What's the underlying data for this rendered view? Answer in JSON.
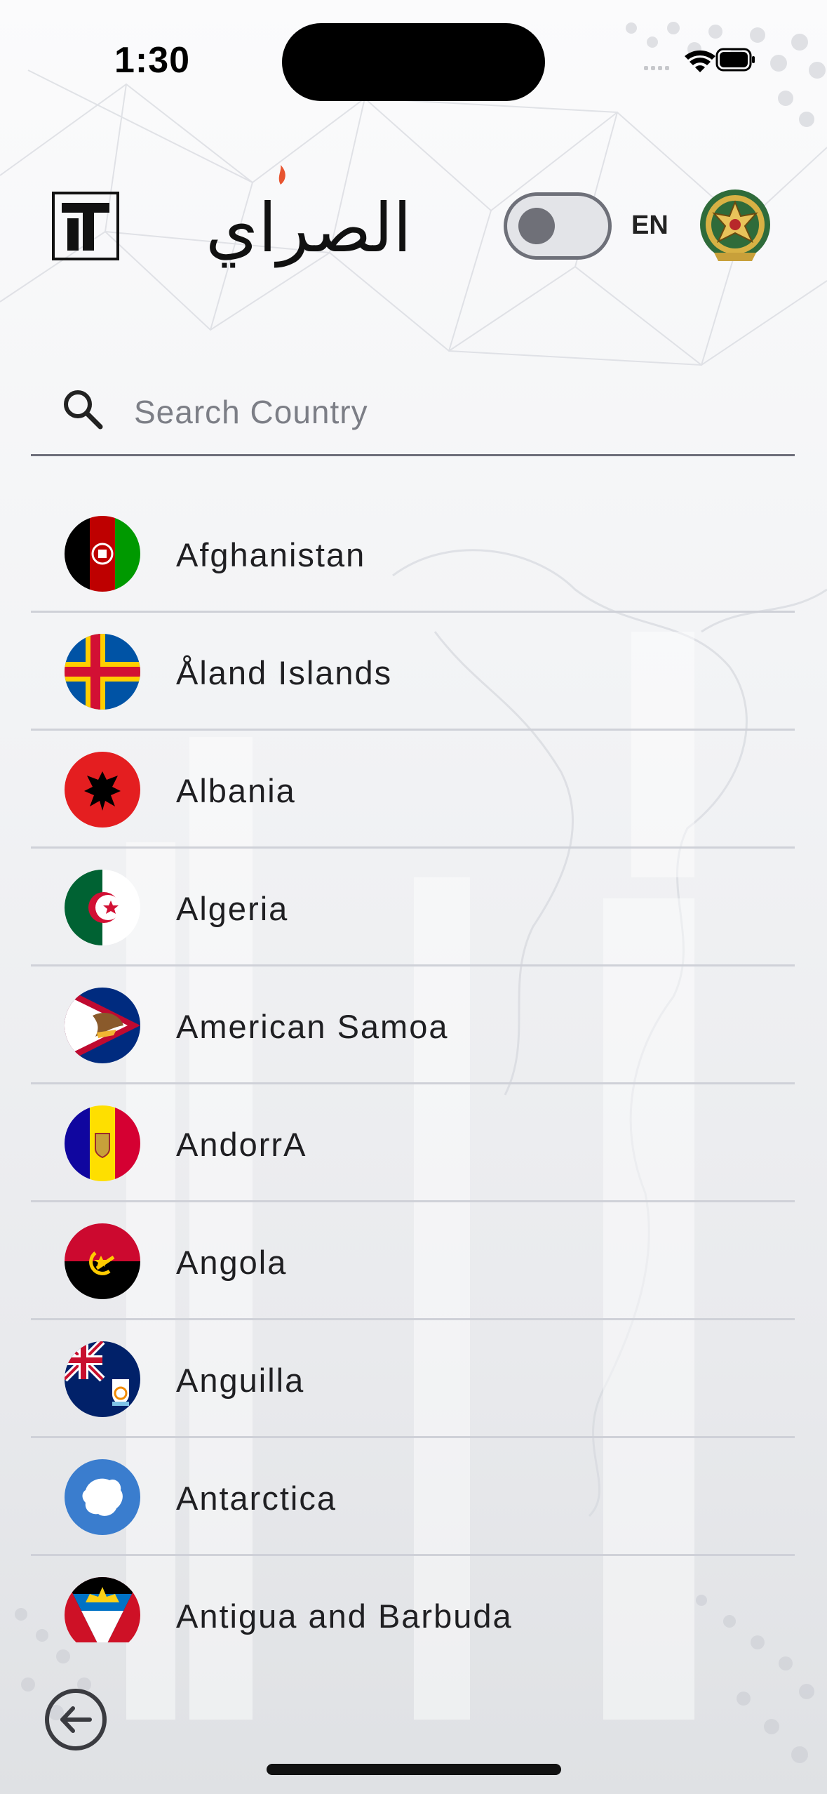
{
  "status_bar": {
    "time": "1:30"
  },
  "header": {
    "brand_text": "الصراي",
    "language_label": "EN",
    "toggle_on": false
  },
  "search": {
    "placeholder": "Search Country",
    "value": ""
  },
  "countries": [
    {
      "name": "Afghanistan",
      "flag_icon": "afghanistan-flag-icon"
    },
    {
      "name": "Åland Islands",
      "flag_icon": "aland-islands-flag-icon"
    },
    {
      "name": "Albania",
      "flag_icon": "albania-flag-icon"
    },
    {
      "name": "Algeria",
      "flag_icon": "algeria-flag-icon"
    },
    {
      "name": "American Samoa",
      "flag_icon": "american-samoa-flag-icon"
    },
    {
      "name": "AndorrA",
      "flag_icon": "andorra-flag-icon"
    },
    {
      "name": "Angola",
      "flag_icon": "angola-flag-icon"
    },
    {
      "name": "Anguilla",
      "flag_icon": "anguilla-flag-icon"
    },
    {
      "name": "Antarctica",
      "flag_icon": "antarctica-flag-icon"
    },
    {
      "name": "Antigua and Barbuda",
      "flag_icon": "antigua-and-barbuda-flag-icon"
    }
  ],
  "colors": {
    "accent": "#e8542f",
    "text": "#1f1f22",
    "divider": "#cfd1d8",
    "toggle_track": "#e3e4e8"
  },
  "icons": {
    "back": "back-arrow-icon",
    "search": "search-icon"
  }
}
